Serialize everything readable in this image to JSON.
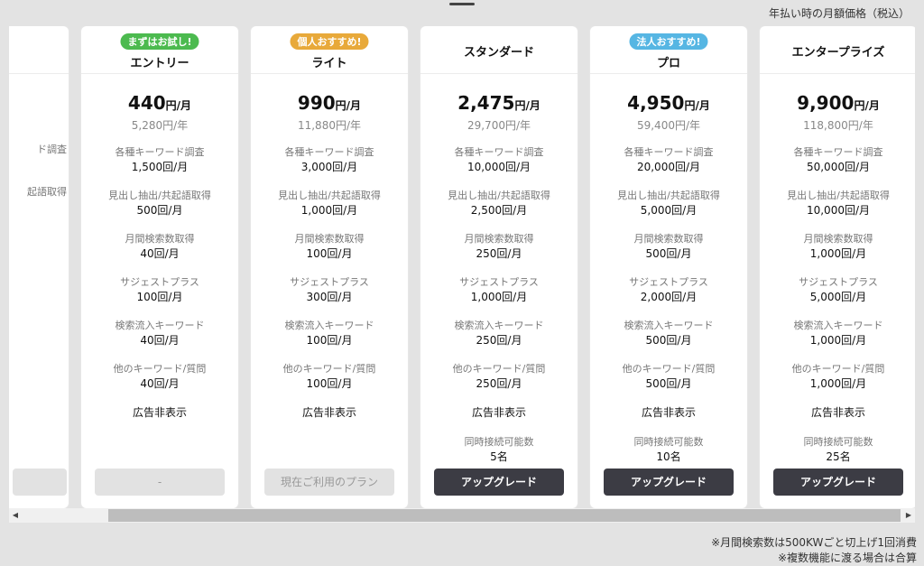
{
  "header": {
    "tax_note": "年払い時の月額価格（税込）"
  },
  "colors": {
    "badge_green": "#4cba4f",
    "badge_orange": "#e8a93a",
    "badge_blue": "#56b6e3",
    "button_dark": "#3c3c44"
  },
  "partial_card": {
    "features": [
      "ド調査",
      "起語取得"
    ]
  },
  "plans": [
    {
      "badge": "まずはお試し!",
      "badge_color": "#4cba4f",
      "name": "エントリー",
      "price": "440",
      "price_unit": "円/月",
      "yearly": "5,280円/年",
      "features": [
        {
          "label": "各種キーワード調査",
          "value": "1,500回/月"
        },
        {
          "label": "見出し抽出/共起語取得",
          "value": "500回/月"
        },
        {
          "label": "月間検索数取得",
          "value": "40回/月"
        },
        {
          "label": "サジェストプラス",
          "value": "100回/月"
        },
        {
          "label": "検索流入キーワード",
          "value": "40回/月"
        },
        {
          "label": "他のキーワード/質問",
          "value": "40回/月"
        }
      ],
      "ad_free": "広告非表示",
      "connections_label": "",
      "connections_value": "",
      "button": "-",
      "button_style": "disabled"
    },
    {
      "badge": "個人おすすめ!",
      "badge_color": "#e8a93a",
      "name": "ライト",
      "price": "990",
      "price_unit": "円/月",
      "yearly": "11,880円/年",
      "features": [
        {
          "label": "各種キーワード調査",
          "value": "3,000回/月"
        },
        {
          "label": "見出し抽出/共起語取得",
          "value": "1,000回/月"
        },
        {
          "label": "月間検索数取得",
          "value": "100回/月"
        },
        {
          "label": "サジェストプラス",
          "value": "300回/月"
        },
        {
          "label": "検索流入キーワード",
          "value": "100回/月"
        },
        {
          "label": "他のキーワード/質問",
          "value": "100回/月"
        }
      ],
      "ad_free": "広告非表示",
      "connections_label": "",
      "connections_value": "",
      "button": "現在ご利用のプラン",
      "button_style": "disabled"
    },
    {
      "badge": "",
      "badge_color": "",
      "name": "スタンダード",
      "price": "2,475",
      "price_unit": "円/月",
      "yearly": "29,700円/年",
      "features": [
        {
          "label": "各種キーワード調査",
          "value": "10,000回/月"
        },
        {
          "label": "見出し抽出/共起語取得",
          "value": "2,500回/月"
        },
        {
          "label": "月間検索数取得",
          "value": "250回/月"
        },
        {
          "label": "サジェストプラス",
          "value": "1,000回/月"
        },
        {
          "label": "検索流入キーワード",
          "value": "250回/月"
        },
        {
          "label": "他のキーワード/質問",
          "value": "250回/月"
        }
      ],
      "ad_free": "広告非表示",
      "connections_label": "同時接続可能数",
      "connections_value": "5名",
      "button": "アップグレード",
      "button_style": "dark"
    },
    {
      "badge": "法人おすすめ!",
      "badge_color": "#56b6e3",
      "name": "プロ",
      "price": "4,950",
      "price_unit": "円/月",
      "yearly": "59,400円/年",
      "features": [
        {
          "label": "各種キーワード調査",
          "value": "20,000回/月"
        },
        {
          "label": "見出し抽出/共起語取得",
          "value": "5,000回/月"
        },
        {
          "label": "月間検索数取得",
          "value": "500回/月"
        },
        {
          "label": "サジェストプラス",
          "value": "2,000回/月"
        },
        {
          "label": "検索流入キーワード",
          "value": "500回/月"
        },
        {
          "label": "他のキーワード/質問",
          "value": "500回/月"
        }
      ],
      "ad_free": "広告非表示",
      "connections_label": "同時接続可能数",
      "connections_value": "10名",
      "button": "アップグレード",
      "button_style": "dark"
    },
    {
      "badge": "",
      "badge_color": "",
      "name": "エンタープライズ",
      "price": "9,900",
      "price_unit": "円/月",
      "yearly": "118,800円/年",
      "features": [
        {
          "label": "各種キーワード調査",
          "value": "50,000回/月"
        },
        {
          "label": "見出し抽出/共起語取得",
          "value": "10,000回/月"
        },
        {
          "label": "月間検索数取得",
          "value": "1,000回/月"
        },
        {
          "label": "サジェストプラス",
          "value": "5,000回/月"
        },
        {
          "label": "検索流入キーワード",
          "value": "1,000回/月"
        },
        {
          "label": "他のキーワード/質問",
          "value": "1,000回/月"
        }
      ],
      "ad_free": "広告非表示",
      "connections_label": "同時接続可能数",
      "connections_value": "25名",
      "button": "アップグレード",
      "button_style": "dark"
    }
  ],
  "footer": {
    "note1": "※月間検索数は500KWごと切上げ1回消費",
    "note2": "※複数機能に渡る場合は合算"
  }
}
